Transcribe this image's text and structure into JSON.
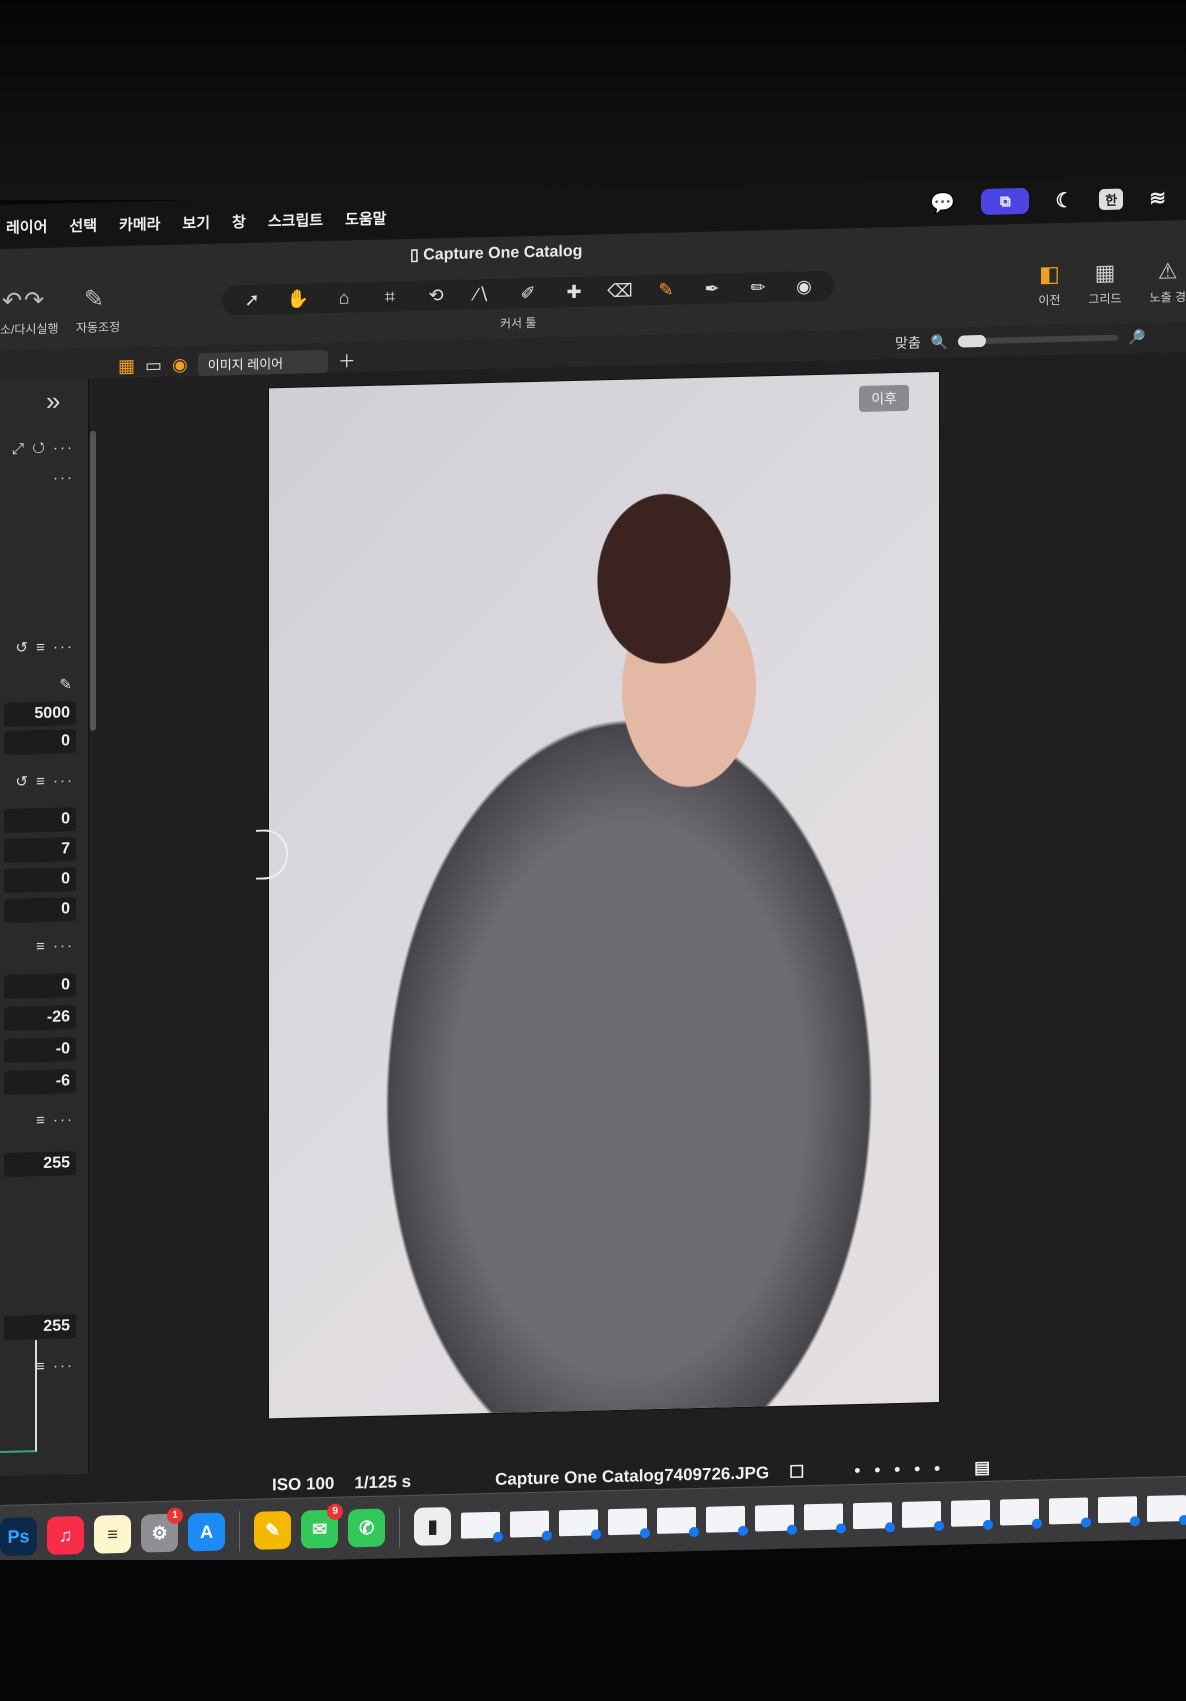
{
  "menubar": {
    "items": [
      "레이어",
      "선택",
      "카메라",
      "보기",
      "창",
      "스크립트",
      "도움말"
    ],
    "status_input_language": "한"
  },
  "window": {
    "title": "Capture One Catalog"
  },
  "toolbar": {
    "undo_redo_label": "소/다시실행",
    "auto_adjust_label": "자동조정",
    "cursor_tools_label": "커서 툴",
    "before_label": "이전",
    "grid_label": "그리드",
    "exposure_label": "노출 경"
  },
  "viewerbar": {
    "layer_select": "이미지 레이어",
    "zoom_label": "맞춤"
  },
  "left_panel": {
    "white_balance_kelvin": "5000",
    "white_balance_tint": "0",
    "exposure_values": [
      "0",
      "7",
      "0",
      "0"
    ],
    "hdr_values": [
      "0",
      "-26",
      "-0",
      "-6"
    ],
    "levels_top": "255",
    "levels_bottom": "255"
  },
  "viewer": {
    "after_badge": "이후",
    "iso": "ISO 100",
    "shutter": "1/125 s",
    "filename": "Capture One Catalog7409726.JPG"
  },
  "dock": {
    "photoshop_label": "Ps",
    "settings_badge": "1",
    "messages_badge": "9"
  },
  "colors": {
    "accent": "#f0a020",
    "chip": "#4b45e6",
    "panel_bg": "#2a2a2b"
  }
}
